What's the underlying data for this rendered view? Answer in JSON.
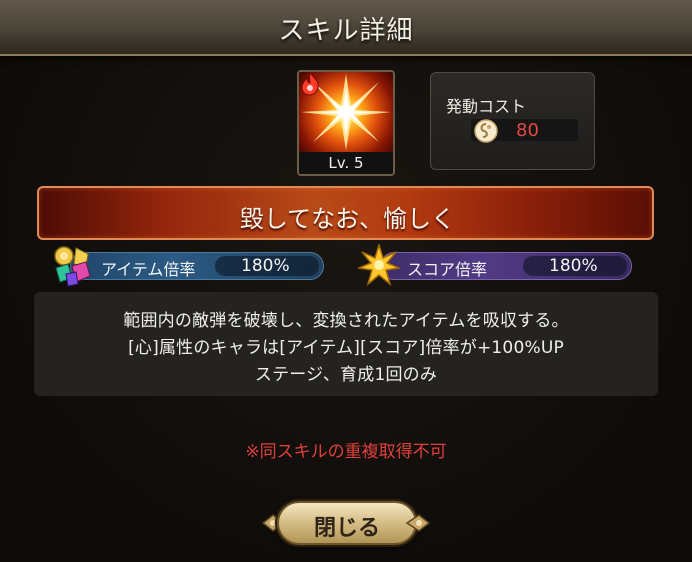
{
  "dialog": {
    "title": "スキル詳細"
  },
  "skill": {
    "icon": "burst-star-icon",
    "attribute_icon": "fire-attribute-icon",
    "level": "Lv. 5",
    "name": "毀してなお、愉しく"
  },
  "cost": {
    "label": "発動コスト",
    "icon": "soul-swirl-icon",
    "value": "80"
  },
  "multipliers": {
    "item": {
      "label": "アイテム倍率",
      "value": "180%",
      "icon": "gems-icon"
    },
    "score": {
      "label": "スコア倍率",
      "value": "180%",
      "icon": "star-burst-icon"
    }
  },
  "description": {
    "line1": "範囲内の敵弾を破壊し、変換されたアイテムを吸収する。",
    "line2": "[心]属性のキャラは[アイテム][スコア]倍率が+100%UP",
    "line3": "ステージ、育成1回のみ"
  },
  "warning": "※同スキルの重複取得不可",
  "buttons": {
    "close": "閉じる"
  },
  "colors": {
    "accent_red": "#e24a42",
    "title_bar": "#4a4337",
    "item_pill": "#2b5a84",
    "score_pill": "#523b86",
    "banner": "#b84a18"
  }
}
